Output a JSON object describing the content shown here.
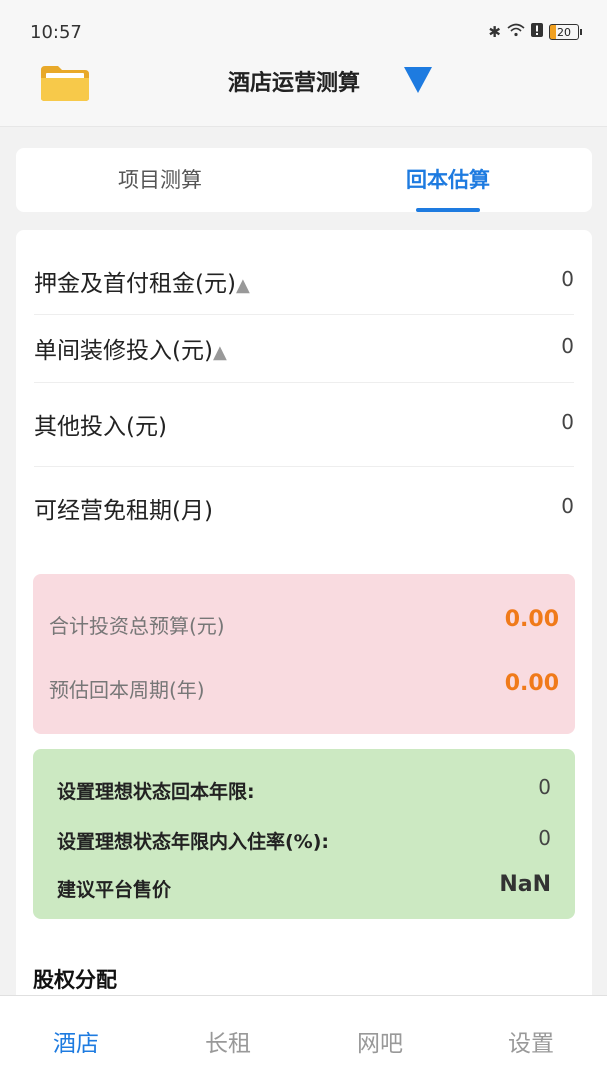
{
  "status_bar": {
    "time": "10:57",
    "battery": "20"
  },
  "app_bar": {
    "title": "酒店运营测算",
    "folder_icon": "folder-icon",
    "menu_icon": "dropdown-triangle-icon"
  },
  "tabs": [
    {
      "label": "项目测算",
      "active": false
    },
    {
      "label": "回本估算",
      "active": true
    }
  ],
  "inputs": [
    {
      "label": "押金及首付租金(元)",
      "marker": "▲",
      "value": "0"
    },
    {
      "label": "单间装修投入(元)",
      "marker": "▲",
      "value": "0"
    },
    {
      "label": "其他投入(元)",
      "marker": "",
      "value": "0"
    },
    {
      "label": "可经营免租期(月)",
      "marker": "",
      "value": "0"
    }
  ],
  "summary": {
    "total_budget_label": "合计投资总预算(元)",
    "total_budget_value": "0.00",
    "payback_label": "预估回本周期(年)",
    "payback_value": "0.00"
  },
  "ideal": {
    "years_label": "设置理想状态回本年限:",
    "years_value": "0",
    "occupancy_label": "设置理想状态年限内入住率(%):",
    "occupancy_value": "0",
    "price_label": "建议平台售价",
    "price_value": "NaN"
  },
  "equity": {
    "title": "股权分配"
  },
  "bottom_nav": [
    {
      "label": "酒店",
      "active": true
    },
    {
      "label": "长租",
      "active": false
    },
    {
      "label": "网吧",
      "active": false
    },
    {
      "label": "设置",
      "active": false
    }
  ],
  "colors": {
    "accent": "#1e7be0",
    "highlight": "#f07a1a",
    "pink_bg": "#f9dbe0",
    "green_bg": "#cce9c2"
  }
}
